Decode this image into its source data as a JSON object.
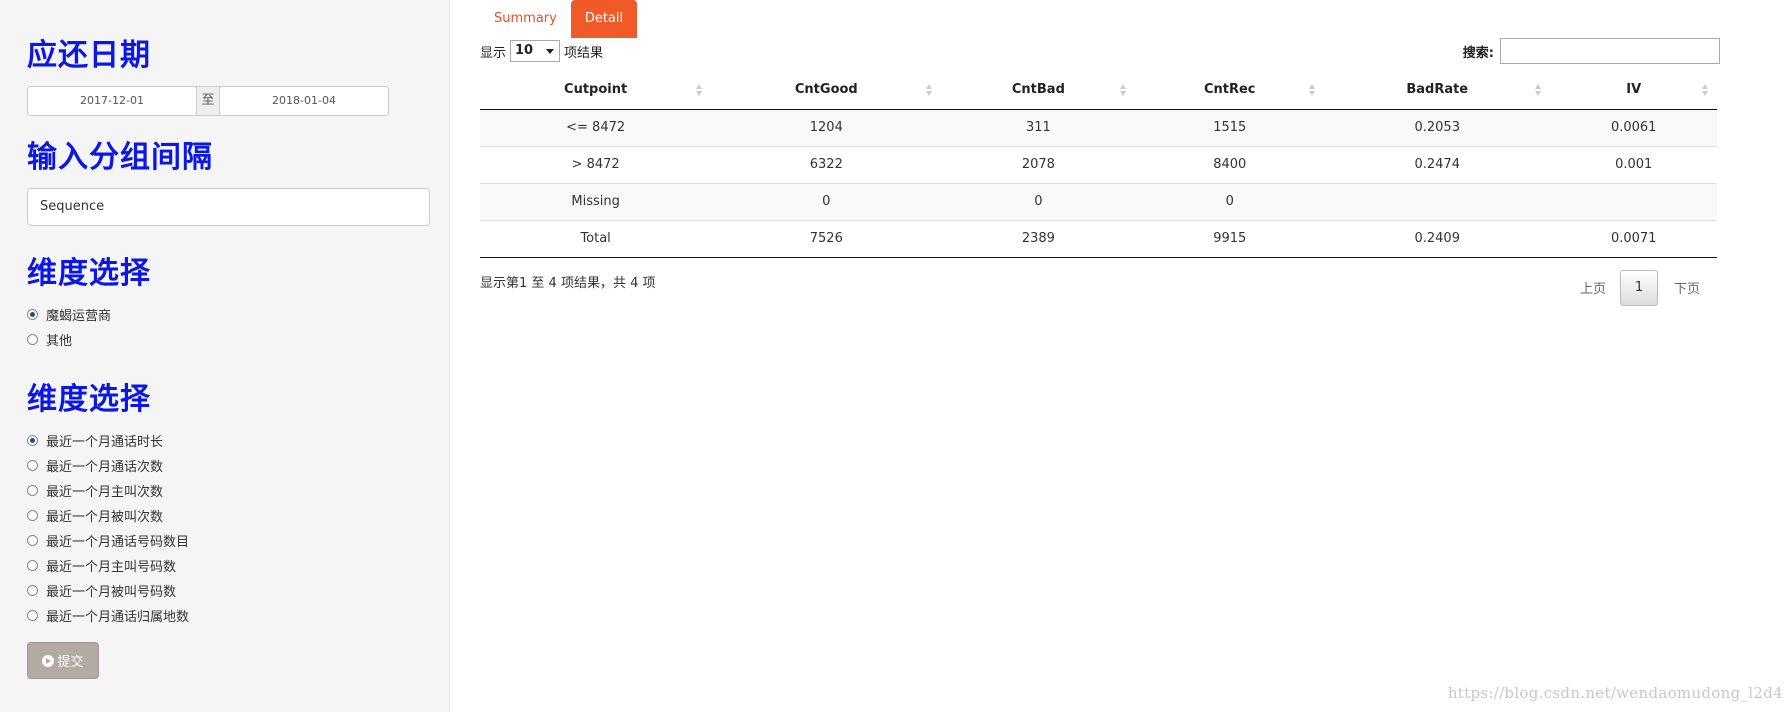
{
  "sidebar": {
    "date_section_title": "应还日期",
    "date_start": "2017-12-01",
    "date_sep": "至",
    "date_end": "2018-01-04",
    "interval_section_title": "输入分组间隔",
    "interval_input_value": "Sequence",
    "dim1_title": "维度选择",
    "dim1_options": [
      {
        "label": "魔蝎运营商",
        "checked": true
      },
      {
        "label": "其他",
        "checked": false
      }
    ],
    "dim2_title": "维度选择",
    "dim2_options": [
      {
        "label": "最近一个月通话时长",
        "checked": true
      },
      {
        "label": "最近一个月通话次数",
        "checked": false
      },
      {
        "label": "最近一个月主叫次数",
        "checked": false
      },
      {
        "label": "最近一个月被叫次数",
        "checked": false
      },
      {
        "label": "最近一个月通话号码数目",
        "checked": false
      },
      {
        "label": "最近一个月主叫号码数",
        "checked": false
      },
      {
        "label": "最近一个月被叫号码数",
        "checked": false
      },
      {
        "label": "最近一个月通话归属地数",
        "checked": false
      }
    ],
    "submit_label": "提交",
    "submit_icon": "play-circle-icon"
  },
  "main": {
    "tabs": [
      {
        "label": "Summary",
        "active": false
      },
      {
        "label": "Detail",
        "active": true
      }
    ],
    "length_prefix": "显示",
    "length_value": "10",
    "length_suffix": "项结果",
    "search_label": "搜索:",
    "search_value": "",
    "table": {
      "columns": [
        "Cutpoint",
        "CntGood",
        "CntBad",
        "CntRec",
        "BadRate",
        "IV"
      ],
      "rows": [
        [
          "<= 8472",
          "1204",
          "311",
          "1515",
          "0.2053",
          "0.0061"
        ],
        [
          "> 8472",
          "6322",
          "2078",
          "8400",
          "0.2474",
          "0.001"
        ],
        [
          "Missing",
          "0",
          "0",
          "0",
          "",
          ""
        ],
        [
          "Total",
          "7526",
          "2389",
          "9915",
          "0.2409",
          "0.0071"
        ]
      ]
    },
    "info_text": "显示第1 至 4 项结果，共 4 项",
    "pager": {
      "prev_label": "上页",
      "current_page": "1",
      "next_label": "下页"
    }
  },
  "watermark": "https://blog.csdn.net/wendaomudong_l2d4",
  "colors": {
    "title_blue": "#0b16e8",
    "tab_orange": "#ef5a28",
    "submit_gray": "#b3aaa4"
  }
}
